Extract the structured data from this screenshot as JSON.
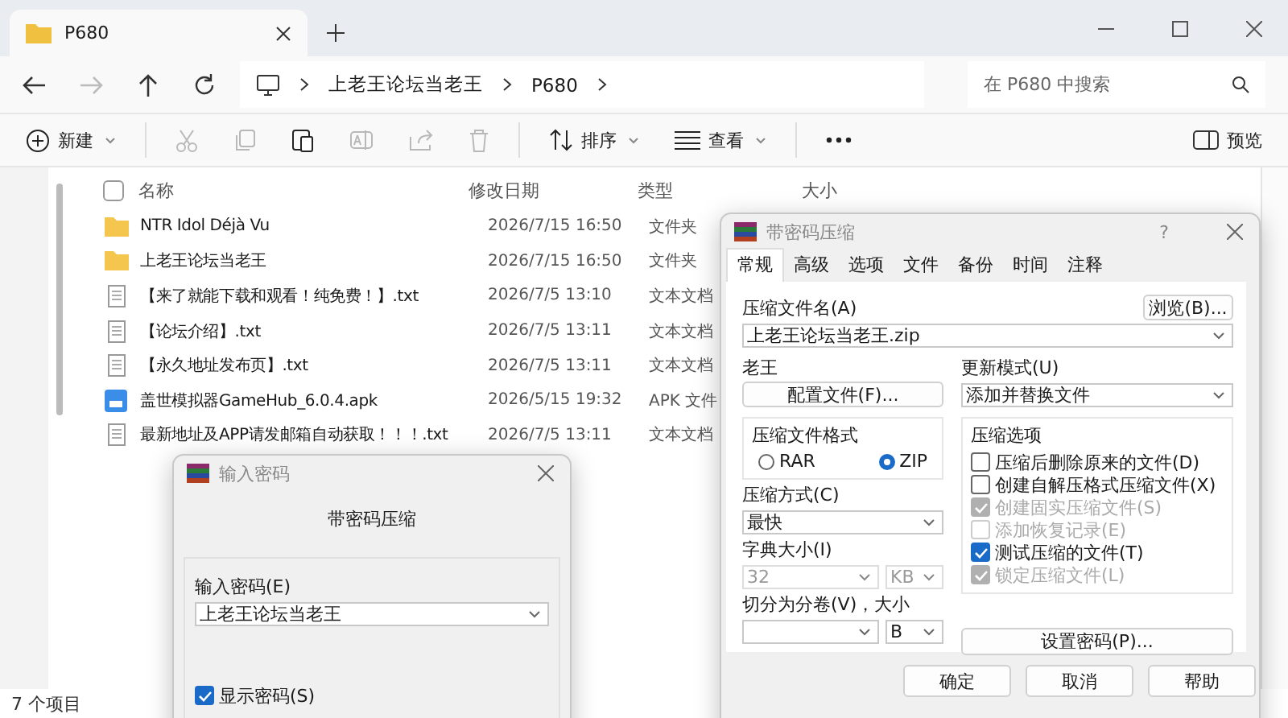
{
  "explorer": {
    "tab_title": "P680",
    "breadcrumb": [
      "上老王论坛当老王",
      "P680"
    ],
    "search": {
      "placeholder": "在 P680 中搜索"
    },
    "toolbar": [
      {
        "kind": "new",
        "label": "新建",
        "disabled": false
      },
      {
        "kind": "cut",
        "disabled": true
      },
      {
        "kind": "copy",
        "disabled": true
      },
      {
        "kind": "paste",
        "disabled": false
      },
      {
        "kind": "rename",
        "disabled": true
      },
      {
        "kind": "share",
        "disabled": true
      },
      {
        "kind": "delete",
        "disabled": true
      },
      {
        "kind": "sort",
        "label": "排序",
        "disabled": false
      },
      {
        "kind": "view",
        "label": "查看",
        "disabled": false
      },
      {
        "kind": "more",
        "disabled": false
      }
    ],
    "preview": "预览",
    "select_all_checked": false,
    "columns": [
      "名称",
      "修改日期",
      "类型",
      "大小"
    ],
    "rows": [
      {
        "kind": "folder",
        "name": "NTR Idol Déjà Vu",
        "date": "2026/7/15 16:50",
        "type": "文件夹"
      },
      {
        "kind": "folder",
        "name": "上老王论坛当老王",
        "date": "2026/7/15 16:50",
        "type": "文件夹"
      },
      {
        "kind": "text",
        "name": "【来了就能下载和观看！纯免费！】.txt",
        "date": "2026/7/5 13:10",
        "type": "文本文档"
      },
      {
        "kind": "text",
        "name": "【论坛介绍】.txt",
        "date": "2026/7/5 13:11",
        "type": "文本文档"
      },
      {
        "kind": "text",
        "name": "【永久地址发布页】.txt",
        "date": "2026/7/5 13:11",
        "type": "文本文档"
      },
      {
        "kind": "apk",
        "name": "盖世模拟器GameHub_6.0.4.apk",
        "date": "2026/5/15 19:32",
        "type": "APK 文件"
      },
      {
        "kind": "text",
        "name": "最新地址及APP请发邮箱自动获取！！！.txt",
        "date": "2026/7/5 13:11",
        "type": "文本文档"
      }
    ],
    "status": "7 个项目"
  },
  "compress_dialog": {
    "title": "带密码压缩",
    "help": "?",
    "tabs": [
      {
        "label": "常规",
        "selected": true
      },
      {
        "label": "高级",
        "selected": false
      },
      {
        "label": "选项",
        "selected": false
      },
      {
        "label": "文件",
        "selected": false
      },
      {
        "label": "备份",
        "selected": false
      },
      {
        "label": "时间",
        "selected": false
      },
      {
        "label": "注释",
        "selected": false
      }
    ],
    "archive_label": "压缩文件名(A)",
    "browse": "浏览(B)...",
    "archive_name": "上老王论坛当老王.zip",
    "profile_label": "老王",
    "profile_button": "配置文件(F)...",
    "update_label": "更新模式(U)",
    "update_mode": "添加并替换文件",
    "format_label": "压缩文件格式",
    "formats": [
      {
        "label": "RAR",
        "selected": false
      },
      {
        "label": "ZIP",
        "selected": true
      }
    ],
    "options_label": "压缩选项",
    "options": [
      {
        "label": "压缩后删除原来的文件(D)",
        "checked": false,
        "disabled": false
      },
      {
        "label": "创建自解压格式压缩文件(X)",
        "checked": false,
        "disabled": false
      },
      {
        "label": "创建固实压缩文件(S)",
        "checked": true,
        "disabled": true
      },
      {
        "label": "添加恢复记录(E)",
        "checked": false,
        "disabled": true
      },
      {
        "label": "测试压缩的文件(T)",
        "checked": true,
        "disabled": false
      },
      {
        "label": "锁定压缩文件(L)",
        "checked": true,
        "disabled": true
      }
    ],
    "method_label": "压缩方式(C)",
    "method": "最快",
    "dict_label": "字典大小(I)",
    "dict": "32",
    "dict_unit": "KB",
    "dict_disabled": true,
    "split_label": "切分为分卷(V)，大小",
    "split_unit": "B",
    "password_button": "设置密码(P)...",
    "buttons": [
      "确定",
      "取消",
      "帮助"
    ]
  },
  "password_dialog": {
    "title": "输入密码",
    "heading": "带密码压缩",
    "label": "输入密码(E)",
    "value": "上老王论坛当老王",
    "show_password": {
      "label": "显示密码(S)",
      "checked": true
    }
  }
}
